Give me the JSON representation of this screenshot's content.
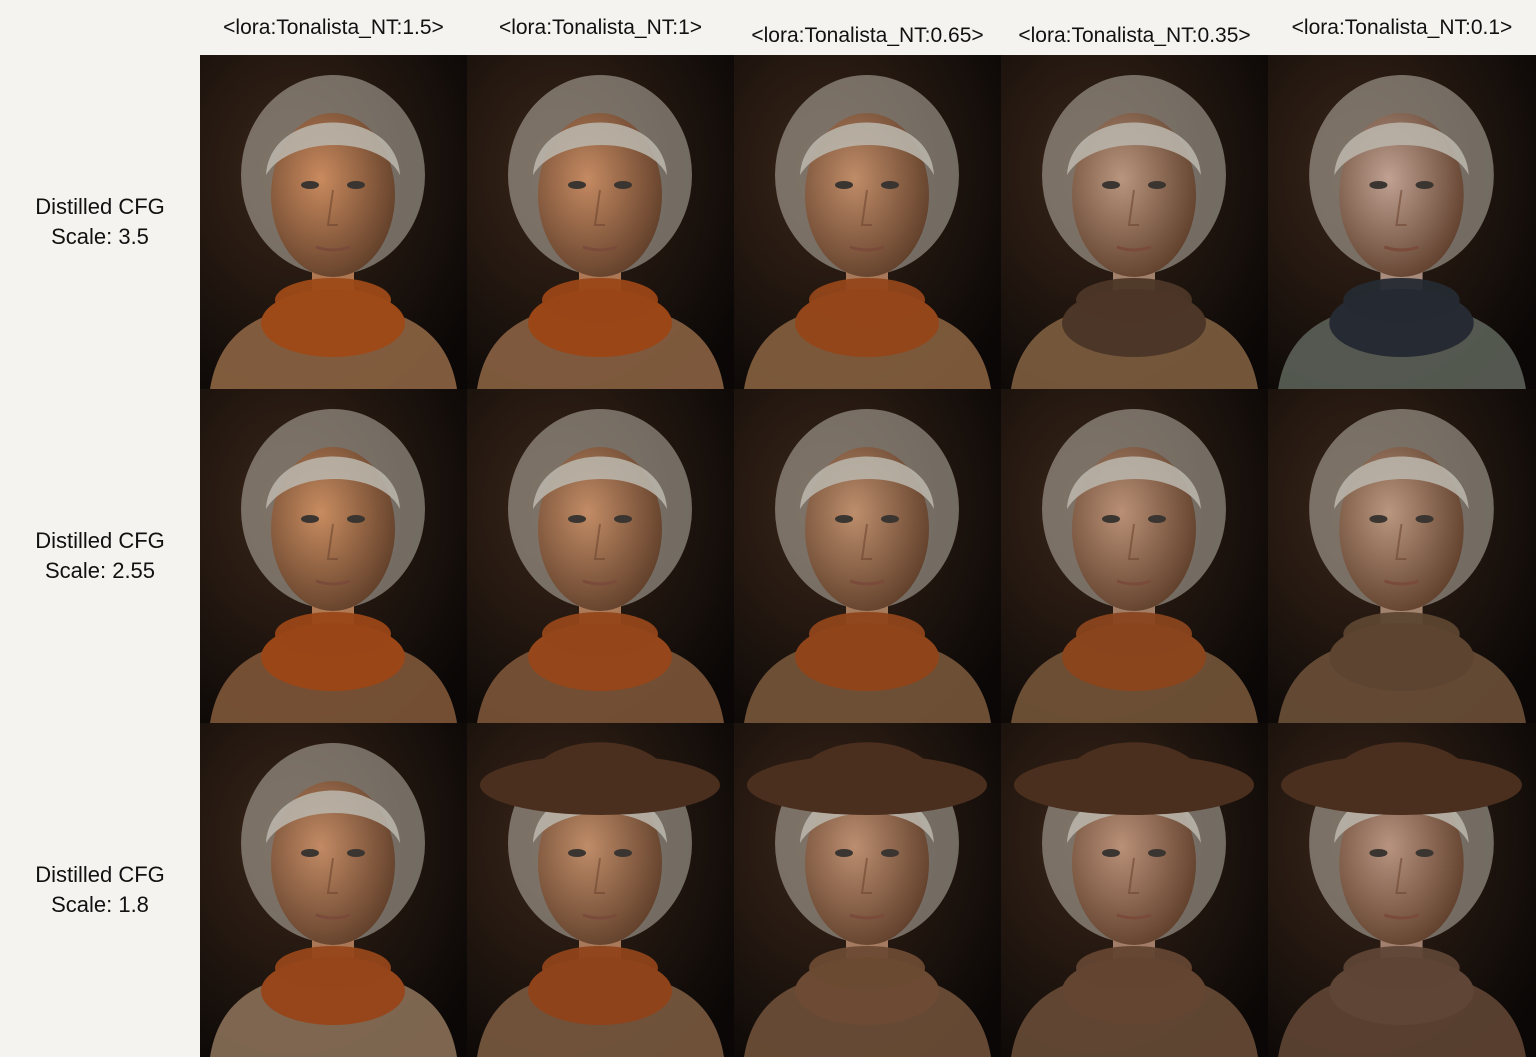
{
  "columns": [
    {
      "label": "<lora:Tonalista_NT:1.5>"
    },
    {
      "label": "<lora:Tonalista_NT:1>"
    },
    {
      "label": "<lora:Tonalista_NT:0.65>"
    },
    {
      "label": "<lora:Tonalista_NT:0.35>"
    },
    {
      "label": "<lora:Tonalista_NT:0.1>"
    }
  ],
  "rows": [
    {
      "line1": "Distilled CFG",
      "line2": "Scale: 3.5"
    },
    {
      "line1": "Distilled CFG",
      "line2": "Scale: 2.55"
    },
    {
      "line1": "Distilled CFG",
      "line2": "Scale: 1.8"
    }
  ],
  "palette": {
    "background": "#f4f3ef",
    "photo_background": "#0c0907",
    "skin_warm": "#c48a62",
    "skin_cool": "#b69a88",
    "hair": "#b9b4aa",
    "scarf_orange": "#9a4a1a",
    "scarf_brown": "#5a3e2a",
    "scarf_grey": "#4e5650",
    "coat": "#8a6444",
    "hat": "#4a2e1e"
  },
  "cells": [
    [
      {
        "scarf": "#9e4a18",
        "coat": "#8d6443",
        "skin": "#c98a5e",
        "hat": false
      },
      {
        "scarf": "#9a4617",
        "coat": "#8a6242",
        "skin": "#c58a62",
        "hat": false
      },
      {
        "scarf": "#93461a",
        "coat": "#86613f",
        "skin": "#c08c68",
        "hat": false
      },
      {
        "scarf": "#4c3627",
        "coat": "#7e5e40",
        "skin": "#b8957e",
        "hat": false
      },
      {
        "scarf": "#252a33",
        "coat": "#5b6158",
        "skin": "#c0a192",
        "hat": false
      }
    ],
    [
      {
        "scarf": "#9a4617",
        "coat": "#7e5638",
        "skin": "#c88c60",
        "hat": false
      },
      {
        "scarf": "#95461a",
        "coat": "#7c5538",
        "skin": "#c28c66",
        "hat": false
      },
      {
        "scarf": "#8f441a",
        "coat": "#77563a",
        "skin": "#bd8e6c",
        "hat": false
      },
      {
        "scarf": "#8a451d",
        "coat": "#745538",
        "skin": "#b99076",
        "hat": false
      },
      {
        "scarf": "#5c4430",
        "coat": "#6c5039",
        "skin": "#b9967f",
        "hat": false
      }
    ],
    [
      {
        "scarf": "#96461a",
        "coat": "#8a7058",
        "skin": "#c28a64",
        "hat": false
      },
      {
        "scarf": "#8f431a",
        "coat": "#7a5a40",
        "skin": "#bf8c68",
        "hat": true
      },
      {
        "scarf": "#6c4a33",
        "coat": "#6f5038",
        "skin": "#bc8e70",
        "hat": true
      },
      {
        "scarf": "#634532",
        "coat": "#674b36",
        "skin": "#b99078",
        "hat": true
      },
      {
        "scarf": "#5e4535",
        "coat": "#5f4534",
        "skin": "#b79380",
        "hat": true
      }
    ]
  ]
}
